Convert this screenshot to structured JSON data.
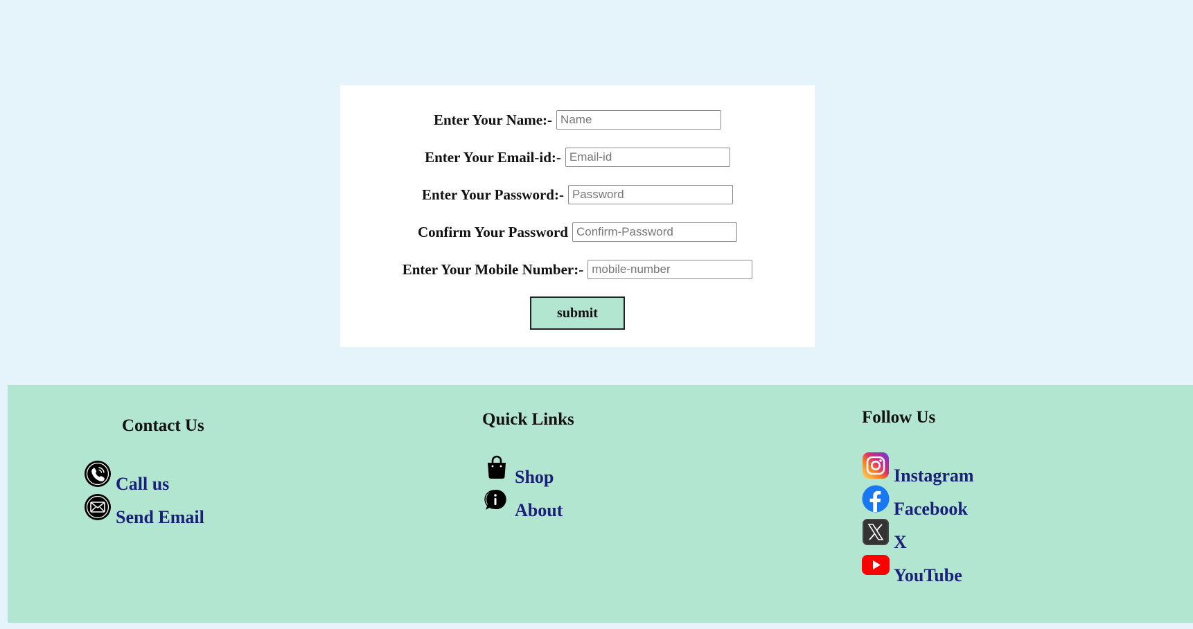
{
  "form": {
    "name_label": "Enter Your Name:-",
    "name_placeholder": "Name",
    "email_label": "Enter Your Email-id:-",
    "email_placeholder": "Email-id",
    "password_label": "Enter Your Password:-",
    "password_placeholder": "Password",
    "confirm_label": "Confirm Your Password",
    "confirm_placeholder": "Confirm-Password",
    "mobile_label": "Enter Your Mobile Number:-",
    "mobile_placeholder": "mobile-number",
    "submit_label": "submit"
  },
  "footer": {
    "contact": {
      "title": "Contact Us",
      "items": [
        {
          "label": "Call us",
          "icon": "phone-icon"
        },
        {
          "label": "Send Email",
          "icon": "envelope-icon"
        }
      ]
    },
    "quick_links": {
      "title": "Quick Links",
      "items": [
        {
          "label": "Shop",
          "icon": "shopping-bag-icon"
        },
        {
          "label": "About",
          "icon": "info-chat-icon"
        }
      ]
    },
    "follow": {
      "title": "Follow Us",
      "items": [
        {
          "label": "Instagram",
          "icon": "instagram-icon"
        },
        {
          "label": "Facebook",
          "icon": "facebook-icon"
        },
        {
          "label": "X",
          "icon": "x-icon"
        },
        {
          "label": "YouTube",
          "icon": "youtube-icon"
        }
      ]
    }
  },
  "colors": {
    "page_bg": "#e4f4fa",
    "footer_bg": "#b3e6d0",
    "link_text": "#1a1f7a",
    "facebook": "#1877f2",
    "youtube": "#ff0000"
  }
}
